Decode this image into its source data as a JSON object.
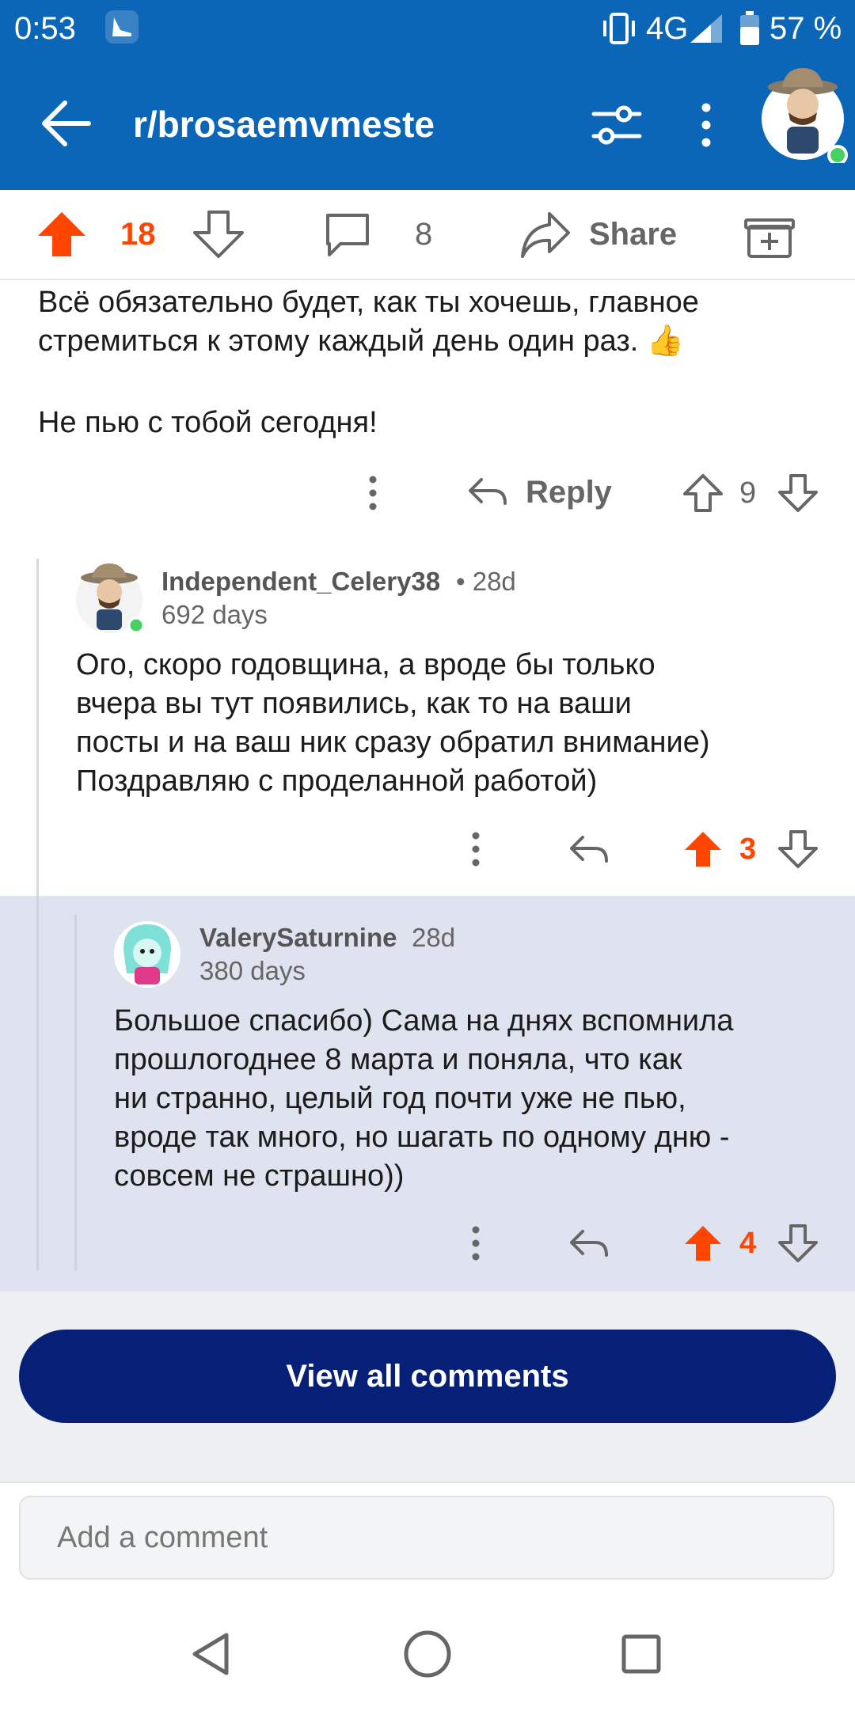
{
  "status": {
    "time": "0:53",
    "network": "4G",
    "battery": "57 %"
  },
  "header": {
    "subreddit": "r/brosaemvmeste"
  },
  "post_bar": {
    "upvotes": "18",
    "comments": "8",
    "share_label": "Share"
  },
  "parent_comment": {
    "lines": [
      "Всё обязательно будет, как ты хочешь, главное",
      "стремиться к этому каждый день один раз. 👍",
      "",
      "Не пью с тобой сегодня!"
    ],
    "reply_label": "Reply",
    "votes": "9"
  },
  "comments": [
    {
      "user": "Independent_Celery38",
      "age": "• 28d",
      "flair": "692 days",
      "lines": [
        "Ого, скоро годовщина, а вроде бы только",
        "вчера вы тут появились, как то на ваши",
        "посты и на ваш ник сразу обратил внимание)",
        "Поздравляю с проделанной работой)"
      ],
      "votes": "3"
    },
    {
      "user": "ValerySaturnine",
      "age": "28d",
      "flair": "380 days",
      "lines": [
        "Большое спасибо) Сама на днях вспомнила",
        "прошлогоднее 8 марта и поняла, что как",
        "ни странно, целый год почти уже не пью,",
        "вроде так много, но шагать по одному дню -",
        "совсем не страшно))"
      ],
      "votes": "4"
    }
  ],
  "view_all_label": "View all comments",
  "composer": {
    "placeholder": "Add a comment"
  },
  "colors": {
    "brand_blue": "#0b66b8",
    "upvote_orange": "#ff4500",
    "button_navy": "#062077",
    "highlight_bg": "#dee3ef"
  }
}
